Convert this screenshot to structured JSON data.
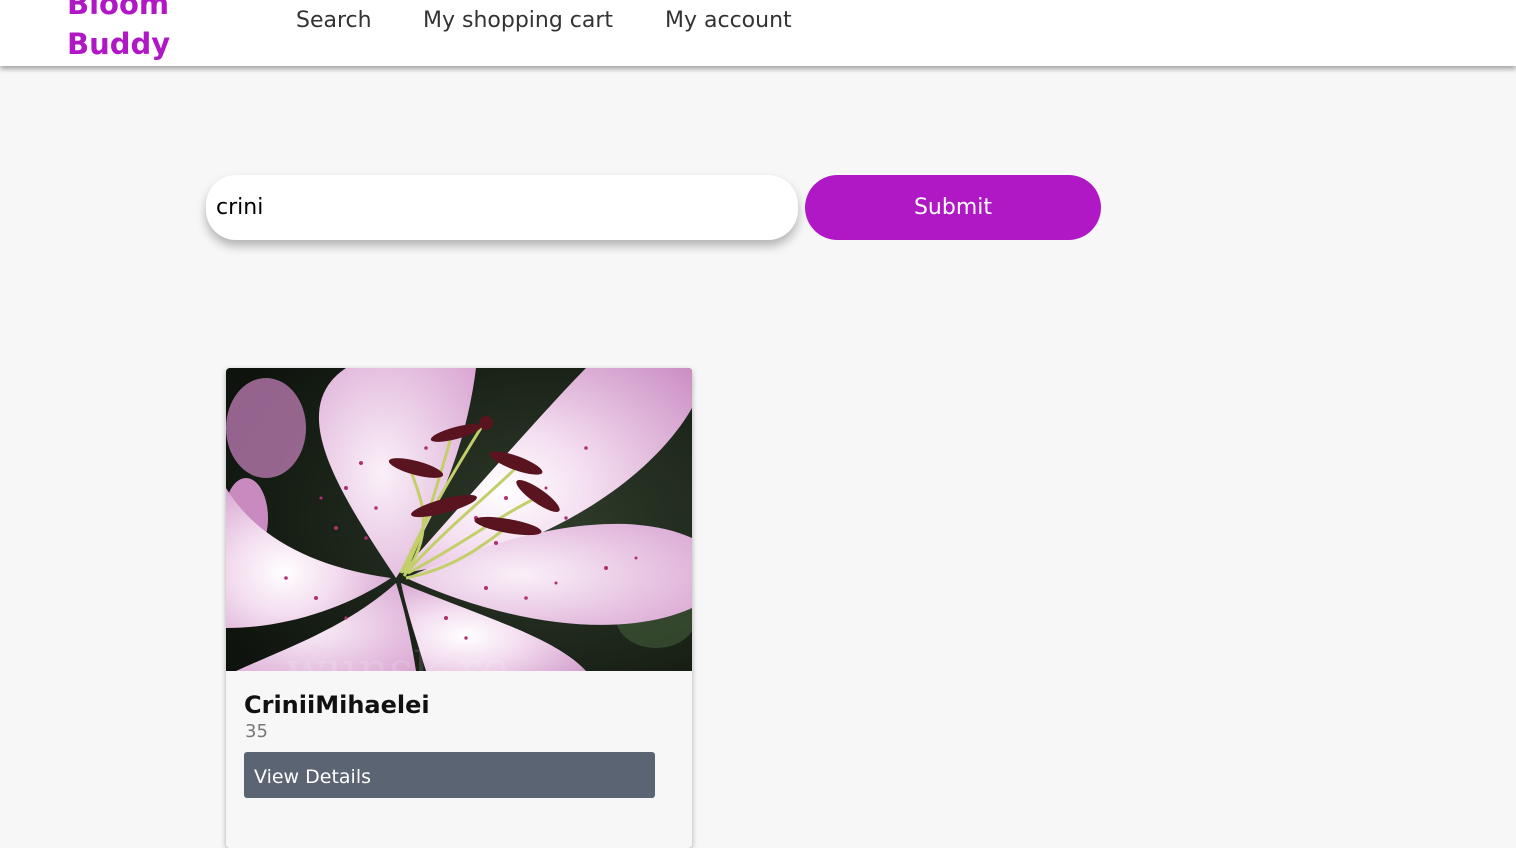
{
  "nav": {
    "brand_line1": "Bloom",
    "brand_line2": "Buddy",
    "links": [
      {
        "label": "Search"
      },
      {
        "label": "My shopping cart"
      },
      {
        "label": "My account"
      }
    ]
  },
  "search": {
    "value": "crini",
    "submit_label": "Submit"
  },
  "results": [
    {
      "name": "CriniiMihaelei",
      "price": "35",
      "button_label": "View Details",
      "image_watermark": "wunsk.ro"
    }
  ],
  "colors": {
    "accent": "#b018c6",
    "button_secondary": "#5a6473",
    "background": "#f7f7f7"
  },
  "icons": {
    "product_image": "pink-lily-flower-photo"
  }
}
